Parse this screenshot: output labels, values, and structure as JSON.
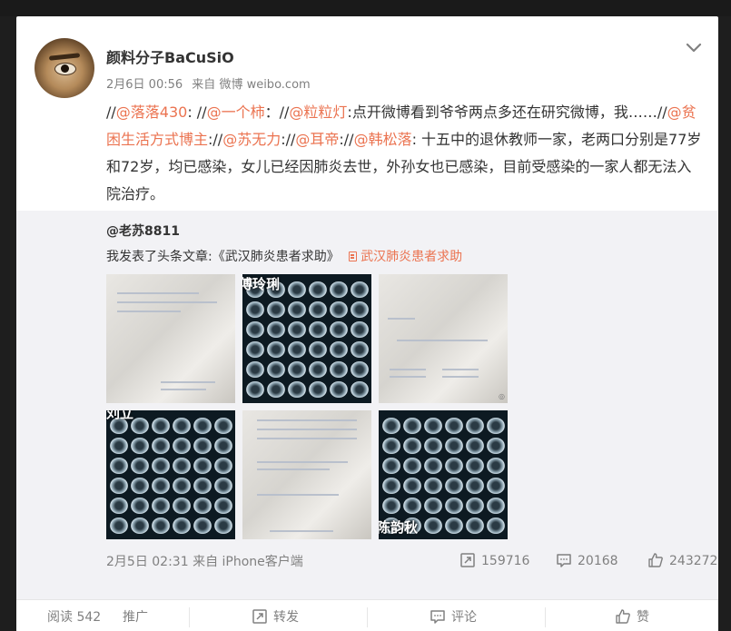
{
  "post": {
    "username": "颜料分子BaCuSiO",
    "date": "2月6日 00:56",
    "source_prefix": "来自",
    "source": "微博 weibo.com",
    "content": {
      "s0": "//",
      "m1": "@落落430",
      "s1": ": //",
      "m2": "@一个柿",
      "s2": "：//",
      "m3": "@粒粒灯",
      "s3": ":点开微博看到爷爷两点多还在研究微博，我……//",
      "m4": "@贫困生活方式博主",
      "s4": "://",
      "m5": "@苏无力",
      "s5": "://",
      "m6": "@耳帝",
      "s6": "://",
      "m7": "@韩松落",
      "s7": ": 十五中的退休教师一家，老两口分别是77岁和72岁，均已感染，女儿已经因肺炎去世，外孙女也已感染，目前受感染的一家人都无法入院治疗。"
    }
  },
  "repost": {
    "username": "@老苏8811",
    "text": "我发表了头条文章:《武汉肺炎患者求助》",
    "link_text": "武汉肺炎患者求助",
    "images": [
      {
        "kind": "document"
      },
      {
        "kind": "ct-scan",
        "label": "傅玲琍"
      },
      {
        "kind": "document"
      },
      {
        "kind": "ct-scan",
        "label": "刘立"
      },
      {
        "kind": "document"
      },
      {
        "kind": "ct-scan",
        "label": "陈韵秋"
      }
    ],
    "time": "2月5日 02:31",
    "source_prefix": "来自",
    "source": "iPhone客户端",
    "reposts": "159716",
    "comments": "20168",
    "likes": "243272"
  },
  "actions": {
    "reads_label": "阅读",
    "reads": "542",
    "promote": "推广",
    "repost": "转发",
    "comment": "评论",
    "like": "赞"
  },
  "colors": {
    "accent": "#eb7350",
    "text": "#333333",
    "muted": "#808080",
    "repost_bg": "#f2f2f5"
  },
  "icons": [
    "chevron-down-icon",
    "link-icon",
    "repost-icon",
    "comment-icon",
    "like-icon"
  ]
}
